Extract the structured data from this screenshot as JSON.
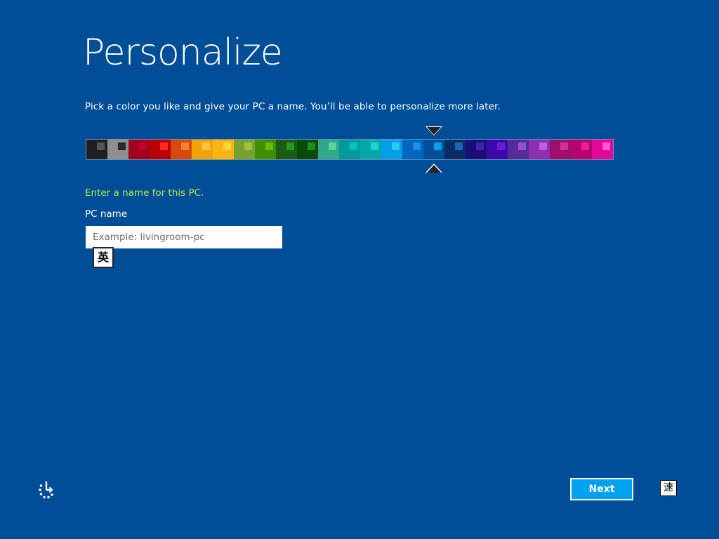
{
  "header": {
    "title": "Personalize",
    "instruction": "Pick a color you like and give your PC a name. You’ll be able to personalize more later."
  },
  "color_palette": {
    "selected_index": 16,
    "swatches": [
      {
        "bg": "#1f1f1f",
        "accent": "#555555"
      },
      {
        "bg": "#8f8f8f",
        "accent": "#2a2a2a"
      },
      {
        "bg": "#a3001e",
        "accent": "#c4002e"
      },
      {
        "bg": "#b80000",
        "accent": "#ff2a1a"
      },
      {
        "bg": "#d84a0c",
        "accent": "#f58035"
      },
      {
        "bg": "#f0a30a",
        "accent": "#ffc23a"
      },
      {
        "bg": "#fab513",
        "accent": "#ffd43a"
      },
      {
        "bg": "#78a22f",
        "accent": "#9ec23a"
      },
      {
        "bg": "#3e8f00",
        "accent": "#6bbf00"
      },
      {
        "bg": "#1c5c12",
        "accent": "#1f9c1f"
      },
      {
        "bg": "#0a4a0a",
        "accent": "#1b8f1b"
      },
      {
        "bg": "#2ea88a",
        "accent": "#5ed19d"
      },
      {
        "bg": "#009a9a",
        "accent": "#00c3c3"
      },
      {
        "bg": "#00a8a8",
        "accent": "#1cd5d5"
      },
      {
        "bg": "#00a0e8",
        "accent": "#2ec7ff"
      },
      {
        "bg": "#0067c1",
        "accent": "#1a8fe8"
      },
      {
        "bg": "#004e98",
        "accent": "#00a1f1"
      },
      {
        "bg": "#0a2b63",
        "accent": "#1a68b8"
      },
      {
        "bg": "#1a0f78",
        "accent": "#4222b5"
      },
      {
        "bg": "#3a0aab",
        "accent": "#6a1cd5"
      },
      {
        "bg": "#552b96",
        "accent": "#9b4cd6"
      },
      {
        "bg": "#8c2fb0",
        "accent": "#c45ae8"
      },
      {
        "bg": "#9b0e6a",
        "accent": "#d42f98"
      },
      {
        "bg": "#b5046d",
        "accent": "#f01a9b"
      },
      {
        "bg": "#e6059a",
        "accent": "#ff5ac8"
      }
    ]
  },
  "pc_name": {
    "prompt": "Enter a name for this PC.",
    "label": "PC name",
    "placeholder": "Example: livingroom-pc",
    "value": ""
  },
  "ime": {
    "input_mode_glyph": "英",
    "tray_glyph": "速"
  },
  "footer": {
    "next_label": "Next",
    "ease_of_access_icon": "ease-of-access-icon"
  }
}
